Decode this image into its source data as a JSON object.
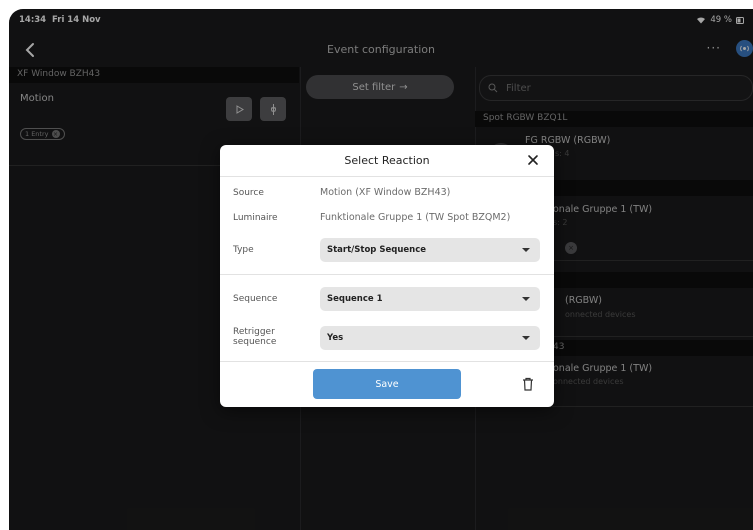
{
  "status": {
    "time": "14:34",
    "date": "Fri 14 Nov",
    "battery": "49 %"
  },
  "nav": {
    "title": "Event configuration",
    "more": "···"
  },
  "left": {
    "header": "XF Window BZH43",
    "card_title": "Motion",
    "chip_label": "1 Entry"
  },
  "middle": {
    "filter_label": "Set filter"
  },
  "right": {
    "search_placeholder": "Filter",
    "header1": "Spot RGBW BZQ1L",
    "card1_title": "FG RGBW (RGBW)",
    "card1_sub": "s: 4",
    "card2_title": "onale Gruppe 1 (TW)",
    "card2_sub": "s: 2",
    "card3_title": "(RGBW)",
    "card3_sub": "onnected devices",
    "header4": "43",
    "card4_title": "onale Gruppe 1 (TW)",
    "card4_sub": "onnected devices"
  },
  "modal": {
    "title": "Select Reaction",
    "source_label": "Source",
    "source_value": "Motion (XF Window BZH43)",
    "luminaire_label": "Luminaire",
    "luminaire_value": "Funktionale Gruppe 1 (TW Spot BZQM2)",
    "type_label": "Type",
    "type_value": "Start/Stop Sequence",
    "sequence_label": "Sequence",
    "sequence_value": "Sequence 1",
    "retrigger_label_1": "Retrigger",
    "retrigger_label_2": "sequence",
    "retrigger_value": "Yes",
    "save_label": "Save"
  },
  "colors": {
    "accent": "#4f93d2",
    "background": "#1b1b1c",
    "modal": "#ffffff"
  }
}
